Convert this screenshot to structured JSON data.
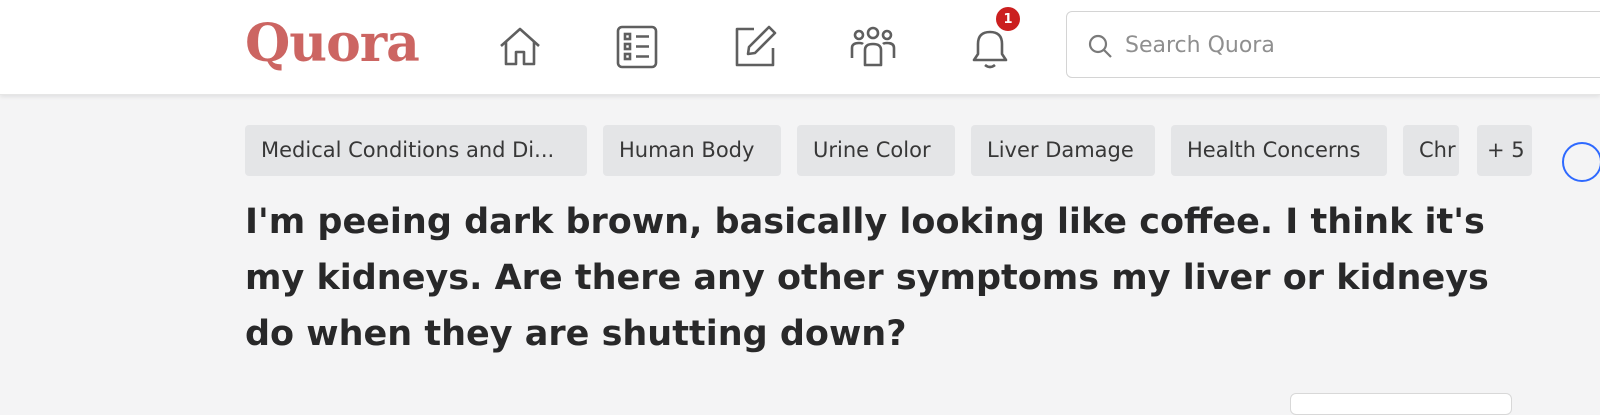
{
  "header": {
    "logo": "Quora",
    "nav": [
      {
        "name": "home",
        "icon": "home-icon"
      },
      {
        "name": "following",
        "icon": "list-icon"
      },
      {
        "name": "answer",
        "icon": "pencil-square-icon"
      },
      {
        "name": "spaces",
        "icon": "people-icon"
      },
      {
        "name": "notifications",
        "icon": "bell-icon",
        "badge": "1"
      }
    ],
    "search": {
      "placeholder": "Search Quora",
      "value": ""
    }
  },
  "topics": [
    "Medical Conditions and Di...",
    "Human Body",
    "Urine Color",
    "Liver Damage",
    "Health Concerns",
    "Chr",
    "+ 5"
  ],
  "question": {
    "title": "I'm peeing dark brown, basically looking like coffee. I think it's my kidneys. Are there any other symptoms my liver or kidneys do when they are shutting down?"
  },
  "colors": {
    "brand": "#b92b27",
    "badge": "#cb1f1f",
    "accent": "#2e69ff"
  }
}
